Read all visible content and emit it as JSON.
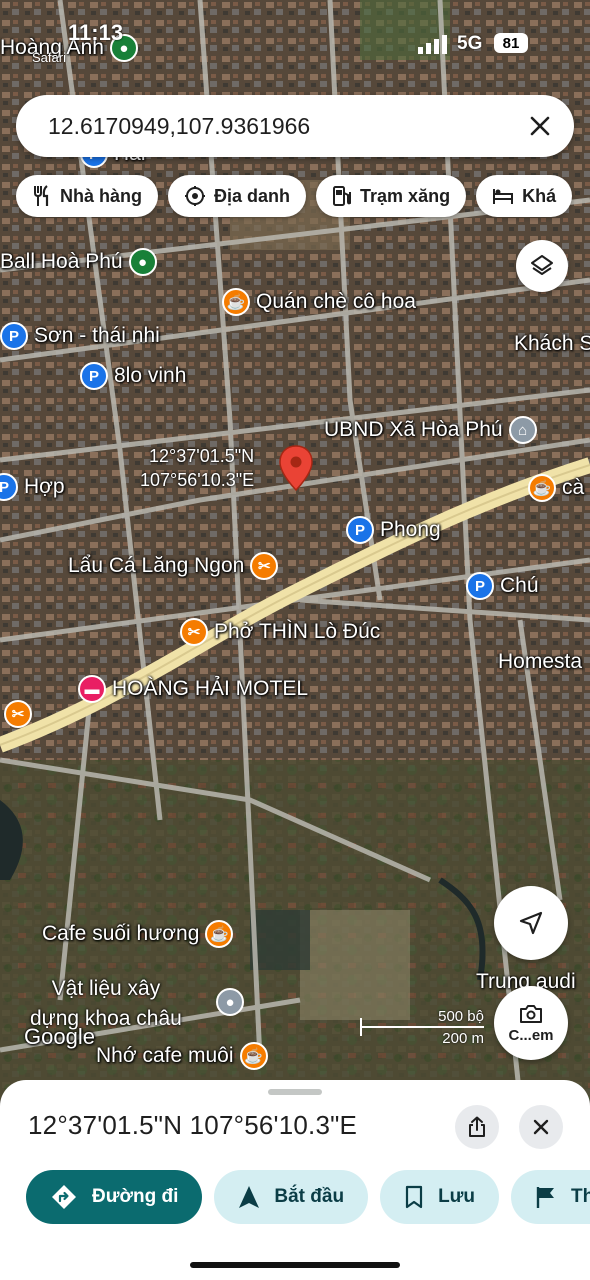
{
  "status": {
    "time": "11:13",
    "back_app": "Safari",
    "network": "5G",
    "battery": "81"
  },
  "search": {
    "query": "12.6170949,107.9361966"
  },
  "chips": [
    {
      "icon": "restaurant-icon",
      "label": "Nhà hàng"
    },
    {
      "icon": "landmark-icon",
      "label": "Địa danh"
    },
    {
      "icon": "gas-station-icon",
      "label": "Trạm xăng"
    },
    {
      "icon": "hotel-icon",
      "label": "Khá"
    }
  ],
  "map": {
    "labels": {
      "hoang_anh": "Hoàng Anh",
      "hai": "Hai",
      "ball_hoa_phu": "Ball Hoà Phú",
      "quan_che": "Quán chè cô hoa",
      "son": "Sơn - thái nhi",
      "tam_lo": "8lo vinh",
      "khach": "Khách S",
      "ubnd": "UBND Xã Hòa Phú",
      "hop": "Hợp",
      "ca": "cà",
      "phong": "Phong",
      "lau_ca": "Lẩu Cá Lăng Ngon",
      "chu": "Chú",
      "pho": "Phở THÌN Lò Đúc",
      "homestay": "Homesta",
      "motel": "HOÀNG HẢI MOTEL",
      "cafe_suoi": "Cafe suối hương",
      "trung": "Trung audi",
      "vat_lieu_1": "Vật liệu xây",
      "vat_lieu_2": "dựng khoa châu",
      "nho_cafe": "Nhớ cafe muôi",
      "google": "Google"
    },
    "dropped_pin": {
      "lat": "12°37'01.5\"N",
      "lng": "107°56'10.3\"E"
    },
    "scale": {
      "top": "500 bộ",
      "bottom": "200 m"
    },
    "camera_label": "C...em",
    "colors": {
      "road": "#f0e2a8",
      "street": "#b9b8b0",
      "pin_red": "#ea4335"
    }
  },
  "sheet": {
    "title": "12°37'01.5\"N 107°56'10.3\"E",
    "actions": [
      {
        "icon": "directions-icon",
        "label": "Đường đi"
      },
      {
        "icon": "navigation-icon",
        "label": "Bắt đầu"
      },
      {
        "icon": "bookmark-icon",
        "label": "Lưu"
      },
      {
        "icon": "flag-icon",
        "label": "Th"
      }
    ]
  }
}
